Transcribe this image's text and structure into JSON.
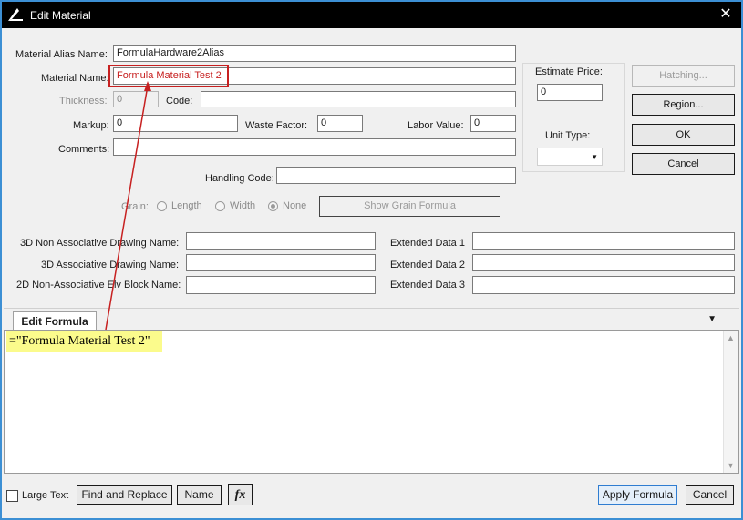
{
  "window": {
    "title": "Edit Material",
    "close_glyph": "✕"
  },
  "fields": {
    "alias_label": "Material Alias Name:",
    "alias_value": "FormulaHardware2Alias",
    "name_label": "Material Name:",
    "name_value": "Formula Material Test 2",
    "thickness_label": "Thickness:",
    "thickness_value": "0",
    "code_label": "Code:",
    "code_value": "",
    "markup_label": "Markup:",
    "markup_value": "0",
    "waste_label": "Waste Factor:",
    "waste_value": "0",
    "labor_label": "Labor Value:",
    "labor_value": "0",
    "comments_label": "Comments:",
    "comments_value": "",
    "handling_label": "Handling Code:",
    "handling_value": ""
  },
  "estimate": {
    "price_label": "Estimate Price:",
    "price_value": "0",
    "unit_label": "Unit Type:",
    "unit_value": ""
  },
  "buttons": {
    "hatching": "Hatching...",
    "region": "Region...",
    "ok": "OK",
    "cancel": "Cancel",
    "show_grain": "Show Grain Formula",
    "find_replace": "Find and Replace",
    "name": "Name",
    "fx": "fx",
    "apply": "Apply Formula",
    "cancel_bottom": "Cancel"
  },
  "grain": {
    "label": "Grain:",
    "options": [
      "Length",
      "Width",
      "None"
    ],
    "selected": "None"
  },
  "drawing": {
    "non_assoc_label": "3D Non Associative Drawing Name:",
    "non_assoc_value": "",
    "assoc_label": "3D Associative Drawing Name:",
    "assoc_value": "",
    "elv_label": "2D Non-Associative Elv Block Name:",
    "elv_value": "",
    "ext1_label": "Extended Data 1",
    "ext1_value": "",
    "ext2_label": "Extended Data 2",
    "ext2_value": "",
    "ext3_label": "Extended Data 3",
    "ext3_value": ""
  },
  "formula": {
    "tab_label": "Edit Formula",
    "text": "=\"Formula Material Test 2\"",
    "large_text_label": "Large Text",
    "large_text_checked": false
  },
  "colors": {
    "annotation": "#c72020",
    "highlight": "#fbfb8c",
    "frame": "#3c8fd4"
  }
}
